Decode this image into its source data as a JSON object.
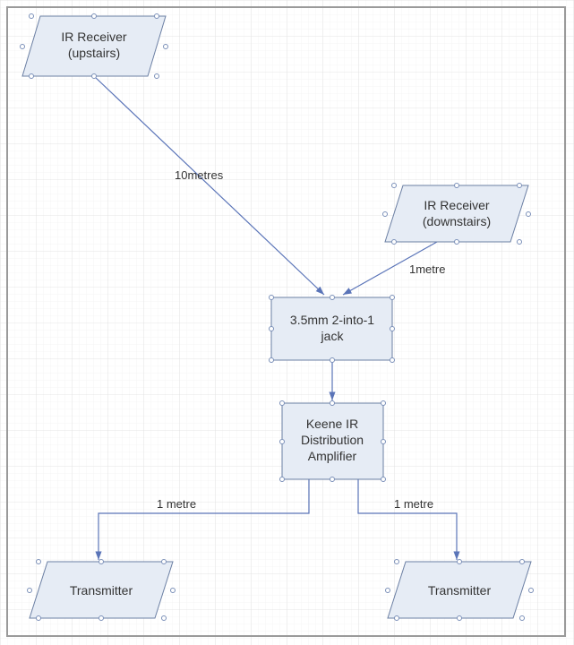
{
  "nodes": {
    "ir_receiver_upstairs": {
      "line1": "IR Receiver",
      "line2": "(upstairs)"
    },
    "ir_receiver_downstairs": {
      "line1": "IR Receiver",
      "line2": "(downstairs)"
    },
    "jack": {
      "line1": "3.5mm 2-into-1",
      "line2": "jack"
    },
    "amp": {
      "line1": "Keene IR",
      "line2": "Distribution",
      "line3": "Amplifier"
    },
    "transmitter_left": {
      "line1": "Transmitter"
    },
    "transmitter_right": {
      "line1": "Transmitter"
    }
  },
  "edges": {
    "upstairs_to_jack": "10metres",
    "downstairs_to_jack": "1metre",
    "amp_to_left": "1 metre",
    "amp_to_right": "1 metre"
  },
  "colors": {
    "node_fill": "#E6ECF5",
    "node_stroke": "#6B7FA3",
    "connector": "#5A74B8",
    "grid_minor": "#E8E8E8",
    "grid_major": "#D8D8D8",
    "border": "#9A9A9A",
    "text": "#333333",
    "handle": "#7A8FB8"
  }
}
